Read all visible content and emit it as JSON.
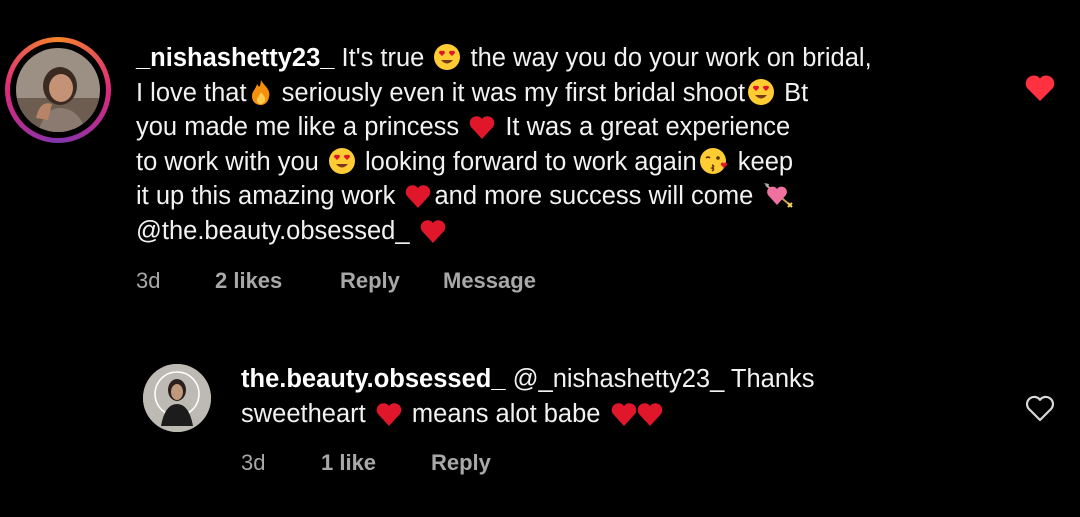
{
  "comments": [
    {
      "username": "_nishashetty23_",
      "lines": [
        [
          "It's true ",
          "heart-eyes",
          " the way you do your work on bridal,"
        ],
        [
          "I love that",
          "fire",
          " seriously even it was my first bridal shoot",
          "heart-eyes",
          " Bt"
        ],
        [
          "you made me like a princess ",
          "red-heart",
          " It was a great experience"
        ],
        [
          "to work with you ",
          "heart-eyes",
          " looking forward to work again",
          "kissing",
          " keep"
        ],
        [
          "it up this amazing work ",
          "red-heart",
          "and more success will come ",
          "heart-arrow"
        ],
        [
          "@the.beauty.obsessed_ ",
          "red-heart"
        ]
      ],
      "time": "3d",
      "likes": "2 likes",
      "reply": "Reply",
      "message": "Message",
      "liked": true
    },
    {
      "username": "the.beauty.obsessed_",
      "mention": "@_nishashetty23_",
      "line1_rest": " Thanks",
      "line2_a": "sweetheart ",
      "line2_b": " means alot babe ",
      "time": "3d",
      "likes": "1 like",
      "reply": "Reply",
      "liked": false
    }
  ],
  "colors": {
    "background": "#000000",
    "meta_text": "#a8a8a8",
    "like_red": "#ff3040",
    "emoji_heart": "#e0162b"
  }
}
